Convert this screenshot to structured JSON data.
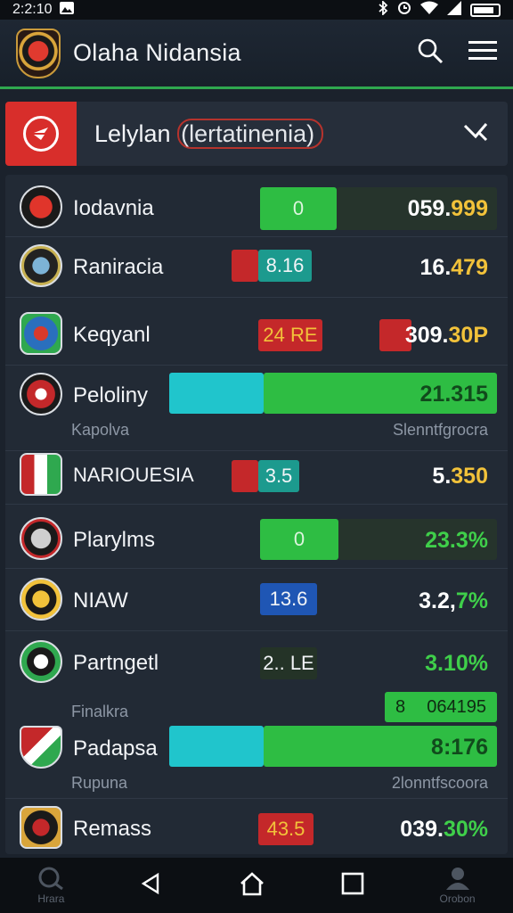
{
  "status": {
    "time": "2:2:10"
  },
  "header": {
    "title": "Olaha Nidansia"
  },
  "league": {
    "name": "Lelylan",
    "subtitle": "(lertatinenia)"
  },
  "teams": [
    {
      "name": "Iodavnia",
      "pill": "0",
      "value_a": "059.",
      "value_b": "999"
    },
    {
      "name": "Raniracia",
      "pill": "8.16",
      "value_a": "16.",
      "value_b": "479"
    },
    {
      "name": "Keqyanl",
      "pill": "24 RE",
      "value_a": "309.",
      "value_b": "30P"
    },
    {
      "name": "Peloliny",
      "value": "21.315",
      "left_label": "Kapolva",
      "right_label": "Slenntfgrocra"
    },
    {
      "name": "NARIOUESIA",
      "pill": "3.5",
      "value_a": "5.",
      "value_b": "350"
    },
    {
      "name": "Plarylms",
      "pill": "0",
      "value": "23.3%"
    },
    {
      "name": "NIAW",
      "pill": "13.6",
      "value_a": "3.2,",
      "value_b": "7%"
    },
    {
      "name": "Partngetl",
      "pill": "2.. LE",
      "value": "3.10%"
    },
    {
      "name": "Padapsa",
      "value": "8:176",
      "top_label": "Finalkra",
      "top_badge_a": "8",
      "top_badge_b": "064195",
      "left_label": "Rupuna",
      "right_label": "2lonntfscoora"
    },
    {
      "name": "Remass",
      "pill": "43.5",
      "value_a": "039.",
      "value_b": "30%"
    }
  ],
  "nav": {
    "left": "Hrara",
    "right": "Orobon"
  },
  "colors": {
    "green": "#2ebd43",
    "cyan": "#20c5cc",
    "red": "#c4282a",
    "teal": "#1c9a8e",
    "blue": "#1f56b4",
    "yellow": "#f2c23a"
  }
}
